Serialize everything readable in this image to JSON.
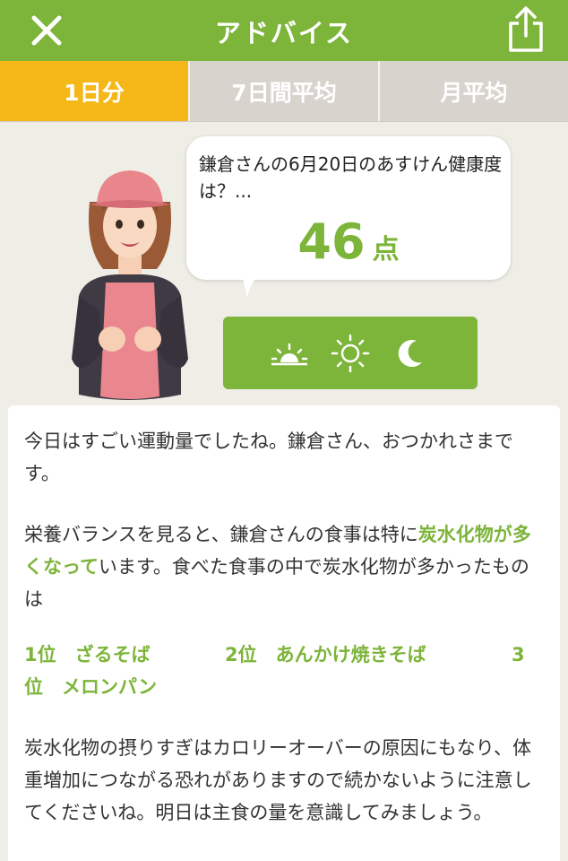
{
  "header": {
    "title": "アドバイス",
    "close_icon": "close-icon",
    "share_icon": "share-icon"
  },
  "tabs": [
    {
      "label": "1日分",
      "active": true
    },
    {
      "label": "7日間平均",
      "active": false
    },
    {
      "label": "月平均",
      "active": false
    }
  ],
  "bubble": {
    "question": "鎌倉さんの6月20日のあすけん健康度は？...",
    "score": "46",
    "unit": "点"
  },
  "time_icons": [
    "sunrise-icon",
    "sun-icon",
    "moon-icon"
  ],
  "advice": {
    "p1": "今日はすごい運動量でしたね。鎌倉さん、おつかれさまです。",
    "p2_pre": "栄養バランスを見ると、鎌倉さんの食事は特に",
    "p2_highlight": "炭水化物が多くなって",
    "p2_post": "います。食べた食事の中で炭水化物が多かったものは",
    "ranking": {
      "first": "1位　ざるそば",
      "second": "2位　あんかけ焼きそば",
      "third_a": "3",
      "third_b": "位　メロンパン"
    },
    "p3": "炭水化物の摂りすぎはカロリーオーバーの原因にもなり、体重増加につながる恐れがありますので続かないように注意してくださいね。明日は主食の量を意識してみましょう。"
  },
  "colors": {
    "accent_green": "#7db43a",
    "tab_active": "#f6b719",
    "tab_inactive": "#d8d4cd",
    "background": "#eeede6"
  }
}
